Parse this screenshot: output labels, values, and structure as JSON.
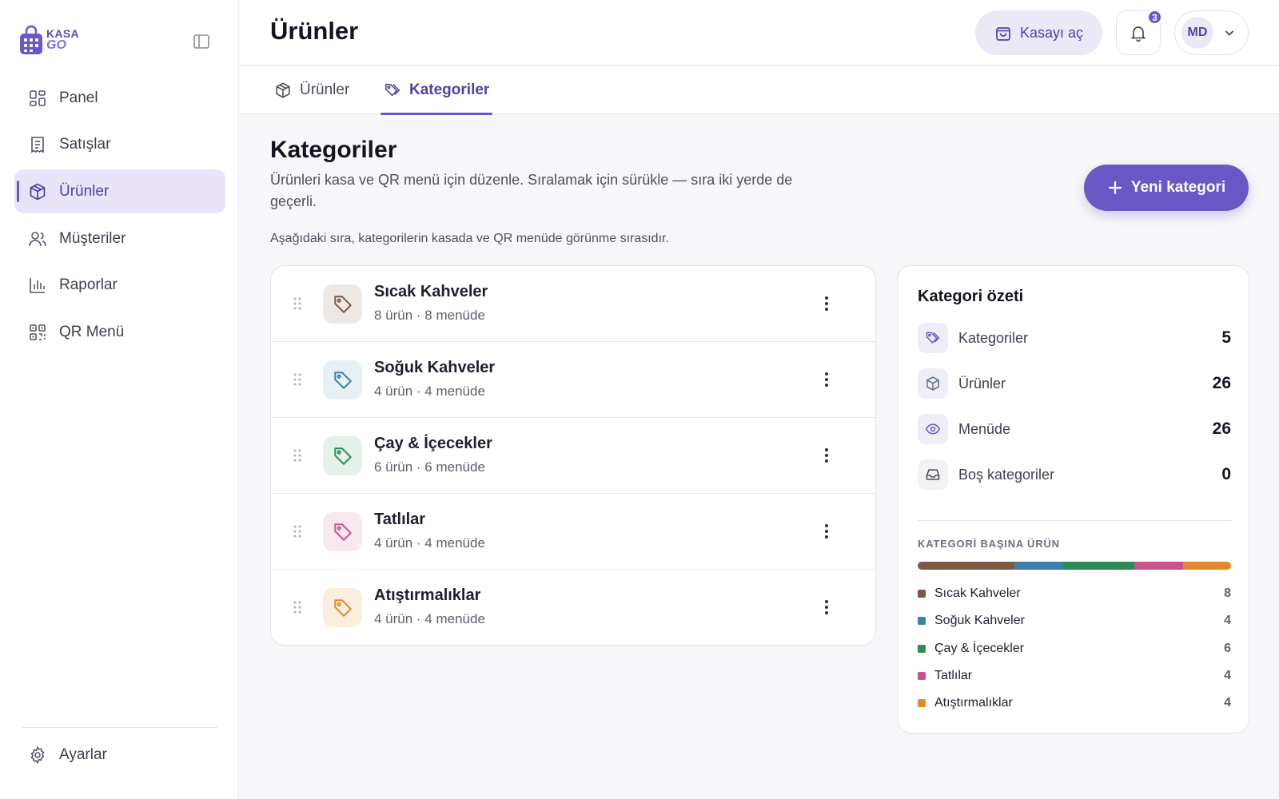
{
  "brand": {
    "line1": "KASA",
    "line2": "GO"
  },
  "sidebar": {
    "items": [
      {
        "label": "Panel"
      },
      {
        "label": "Satışlar"
      },
      {
        "label": "Ürünler"
      },
      {
        "label": "Müşteriler"
      },
      {
        "label": "Raporlar"
      },
      {
        "label": "QR Menü"
      }
    ],
    "settings_label": "Ayarlar"
  },
  "header": {
    "title": "Ürünler",
    "cashier_button": "Kasayı aç",
    "notifications_count": "3",
    "user_initials": "MD"
  },
  "tabs": [
    {
      "label": "Ürünler"
    },
    {
      "label": "Kategoriler"
    }
  ],
  "main": {
    "title": "Kategoriler",
    "description": "Ürünleri kasa ve QR menü için düzenle. Sıralamak için sürükle — sıra iki yerde de geçerli.",
    "new_button": "Yeni kategori",
    "order_note": "Aşağıdaki sıra, kategorilerin kasada ve QR menüde görünme sırasıdır."
  },
  "categories": [
    {
      "name": "Sıcak Kahveler",
      "meta": "8 ürün · 8 menüde",
      "color": "#7a5a45",
      "bg": "#efe9e5"
    },
    {
      "name": "Soğuk Kahveler",
      "meta": "4 ürün · 4 menüde",
      "color": "#3d7fa8",
      "bg": "#e6f0f5"
    },
    {
      "name": "Çay & İçecekler",
      "meta": "6 ürün · 6 menüde",
      "color": "#2f8a55",
      "bg": "#e5f2ea"
    },
    {
      "name": "Tatlılar",
      "meta": "4 ürün · 4 menüde",
      "color": "#c95290",
      "bg": "#f8e8f0"
    },
    {
      "name": "Atıştırmalıklar",
      "meta": "4 ürün · 4 menüde",
      "color": "#e08a2e",
      "bg": "#fbeedd"
    }
  ],
  "summary": {
    "title": "Kategori özeti",
    "stats": [
      {
        "label": "Kategoriler",
        "value": "5",
        "icon": "tag-icon"
      },
      {
        "label": "Ürünler",
        "value": "26",
        "icon": "box-icon"
      },
      {
        "label": "Menüde",
        "value": "26",
        "icon": "eye-icon"
      },
      {
        "label": "Boş kategoriler",
        "value": "0",
        "icon": "inbox-icon"
      }
    ],
    "breakdown_title": "KATEGORİ BAŞINA ÜRÜN",
    "breakdown": [
      {
        "name": "Sıcak Kahveler",
        "value": 8,
        "color": "#7a5a45"
      },
      {
        "name": "Soğuk Kahveler",
        "value": 4,
        "color": "#3d7fa8"
      },
      {
        "name": "Çay & İçecekler",
        "value": 6,
        "color": "#2f8a55"
      },
      {
        "name": "Tatlılar",
        "value": 4,
        "color": "#c95290"
      },
      {
        "name": "Atıştırmalıklar",
        "value": 4,
        "color": "#e08a2e"
      }
    ]
  },
  "colors": {
    "accent": "#6a57c6",
    "accent_soft": "#e9e4f8"
  }
}
